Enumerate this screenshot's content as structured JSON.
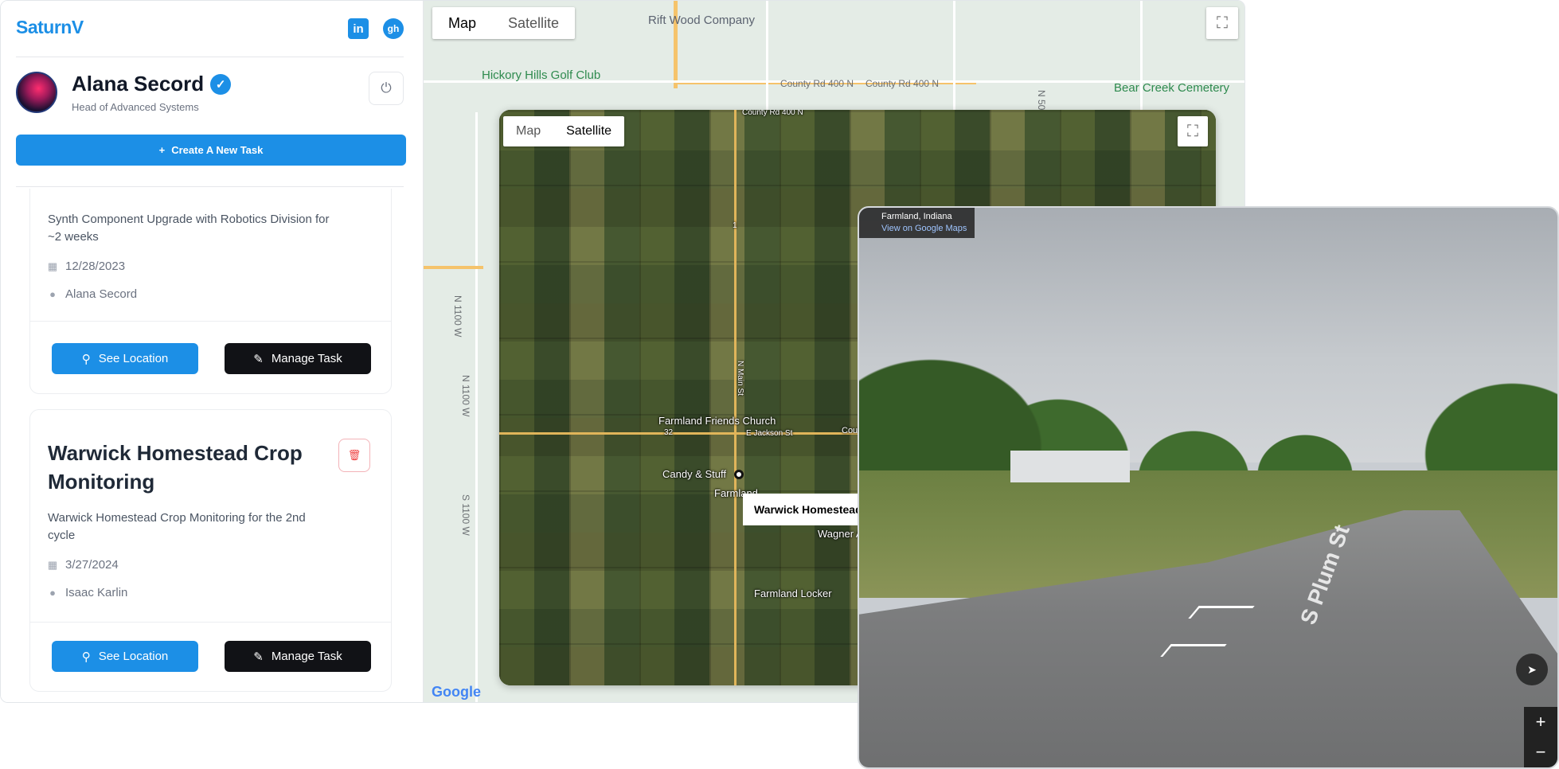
{
  "brand": {
    "name": "SaturnV"
  },
  "header": {
    "linkedin_label": "in",
    "github_label": "gh"
  },
  "user": {
    "name": "Alana Secord",
    "role": "Head of Advanced Systems"
  },
  "actions": {
    "create_task": "Create A New Task"
  },
  "tasks": [
    {
      "title": "",
      "description": "Synth Component Upgrade with Robotics Division for ~2 weeks",
      "date": "12/28/2023",
      "assignee": "Alana Secord",
      "see_location": "See Location",
      "manage_task": "Manage Task"
    },
    {
      "title": "Warwick Homestead Crop Monitoring",
      "description": "Warwick Homestead Crop Monitoring for the 2nd cycle",
      "date": "3/27/2024",
      "assignee": "Isaac Karlin",
      "see_location": "See Location",
      "manage_task": "Manage Task"
    }
  ],
  "map": {
    "tab_map": "Map",
    "tab_satellite": "Satellite",
    "labels": {
      "rift_wood": "Rift Wood Company",
      "hickory": "Hickory Hills Golf Club",
      "bear_creek": "Bear Creek Cemetery",
      "cr400_a": "County Rd 400 N",
      "cr400_b": "County Rd 400 N",
      "n1100w_a": "N 1100 W",
      "n1100w_b": "N 1100 W",
      "s1100w": "S 1100 W",
      "n50": "N 50",
      "shield_1": "1"
    },
    "google": "Google"
  },
  "satellite": {
    "tab_map": "Map",
    "tab_satellite": "Satellite",
    "labels": {
      "friends_church": "Farmland Friends Church",
      "candy": "Candy & Stuff",
      "farmland": "Farmland",
      "locker": "Farmland Locker",
      "wagner": "Wagner A",
      "jackson": "E Jackson St",
      "main_st": "N Main St",
      "county": "Coun",
      "cr400": "County Rd 400 N",
      "route_32": "32",
      "route_1": "1"
    },
    "info_window": "Warwick Homestead"
  },
  "streetview": {
    "location": "Farmland, Indiana",
    "view_link": "View on Google Maps",
    "street_name": "S Plum St",
    "zoom_in": "+",
    "zoom_out": "−"
  }
}
